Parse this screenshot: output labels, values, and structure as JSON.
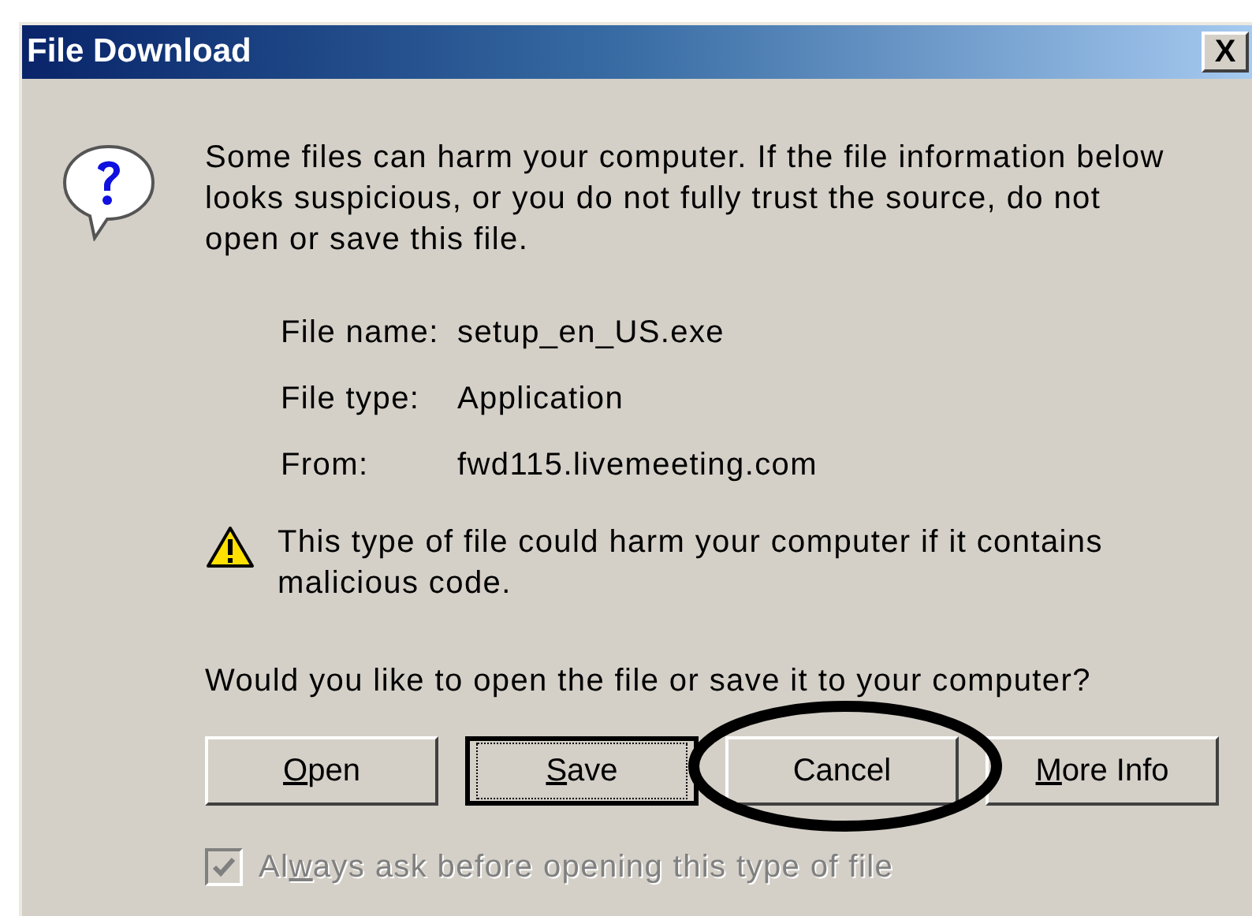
{
  "window": {
    "title": "File Download",
    "close": "X"
  },
  "message": "Some files can harm your computer. If the file information below looks suspicious, or you do not fully trust the source, do not open or save this file.",
  "file_info": [
    {
      "label": "File name:",
      "value": "setup_en_US.exe"
    },
    {
      "label": "File type:",
      "value": "Application"
    },
    {
      "label": "From:",
      "value": "fwd115.livemeeting.com"
    }
  ],
  "warning": "This type of file could harm your computer if it contains malicious code.",
  "question": "Would you like to open the file or save it to your computer?",
  "buttons": [
    {
      "key": "O",
      "after": "pen",
      "focused": false
    },
    {
      "key": "S",
      "after": "ave",
      "focused": true
    },
    {
      "before": "Cancel",
      "focused": false
    },
    {
      "key": "M",
      "after": "ore Info",
      "focused": false
    }
  ],
  "checkbox": {
    "before": "Al",
    "key": "w",
    "after": "ays ask before opening this type of file",
    "checked": true,
    "disabled": true
  },
  "annotation": {
    "kind": "ellipse"
  }
}
